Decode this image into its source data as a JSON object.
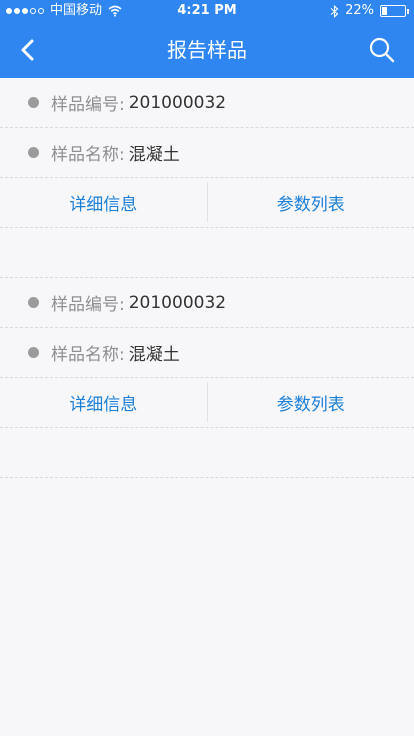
{
  "status_bar": {
    "carrier": "中国移动",
    "time": "4:21 PM",
    "battery": "22%",
    "battery_level": 0.22
  },
  "nav": {
    "title": "报告样品"
  },
  "samples": [
    {
      "code_label": "样品编号:",
      "code_value": "201000032",
      "name_label": "样品名称:",
      "name_value": "混凝土",
      "detail_label": "详细信息",
      "params_label": "参数列表"
    },
    {
      "code_label": "样品编号:",
      "code_value": "201000032",
      "name_label": "样品名称:",
      "name_value": "混凝土",
      "detail_label": "详细信息",
      "params_label": "参数列表"
    }
  ]
}
